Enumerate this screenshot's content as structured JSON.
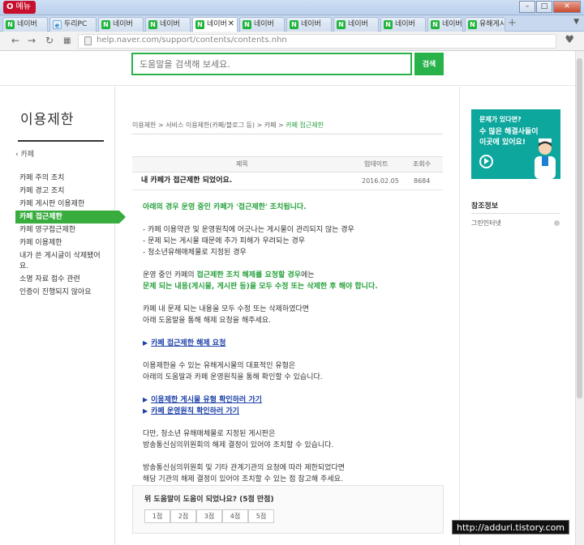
{
  "browser": {
    "menu_label": "메뉴",
    "tabs": [
      {
        "label": "네이버",
        "icon": "naver"
      },
      {
        "label": "두리PC",
        "icon": "ie"
      },
      {
        "label": "네이버",
        "icon": "naver"
      },
      {
        "label": "네이버",
        "icon": "naver"
      },
      {
        "label": "네이버",
        "icon": "naver"
      },
      {
        "label": "네이버",
        "icon": "naver"
      },
      {
        "label": "네이버",
        "icon": "naver"
      },
      {
        "label": "네이버",
        "icon": "naver"
      },
      {
        "label": "네이버",
        "icon": "naver"
      },
      {
        "label": "네이버",
        "icon": "naver"
      },
      {
        "label": "유해게시",
        "icon": "naver"
      }
    ],
    "url": "help.naver.com/support/contents/contents.nhn"
  },
  "search": {
    "placeholder": "도움말을 검색해 보세요.",
    "button_label": "검색"
  },
  "leftnav": {
    "title": "이용제한",
    "back_label": "카페",
    "items": [
      "카페 주의 조치",
      "카페 경고 조치",
      "카페 게시판 이용제한",
      "카페 접근제한",
      "카페 영구접근제한",
      "카페 이용제한",
      "내가 쓴 게시글이 삭제됐어요.",
      "소명 자료 접수 관련",
      "인증이 진행되지 않아요"
    ]
  },
  "breadcrumb": {
    "items": [
      "이용제한",
      "서비스 이용제한(카페/블로그 등)",
      "카페"
    ],
    "current": "카페 접근제한"
  },
  "table": {
    "headers": {
      "title": "제목",
      "date": "업데이트",
      "views": "조회수"
    },
    "row": {
      "title": "내 카페가 접근제한 되었어요.",
      "date": "2016.02.05",
      "views": "8684"
    }
  },
  "article": {
    "intro": "아래의 경우 운영 중인 카페가 '접근제한' 조치됩니다.",
    "bullets": [
      "- 카페 이용약관 및 운영원칙에 어긋나는 게시물이 관리되지 않는 경우",
      "- 문제 되는 게시물 때문에 추가 피해가 우려되는 경우",
      "- 청소년유해매체물로 지정된 경우"
    ],
    "p2_a": "운영 중인 카페의 ",
    "p2_b": "접근제한 조치 해제를 요청할 경우",
    "p2_c": "에는",
    "p2_line2_a": "문제 되는 내용(게시물, 게시판 등)",
    "p2_line2_b": "을 모두 수정 또는 삭제한 후 해야 합니다.",
    "p3": [
      "카페 내 문제 되는 내용을 모두 수정 또는 삭제하였다면",
      "아래 도움말을 통해 해제 요청을 해주세요."
    ],
    "link1": "카페 접근제한 해제 요청",
    "p4": [
      "이용제한을 수 있는 유해게시물의 대표적인 유형은",
      "아래의 도움말과 카페 운영원칙을 통해 확인할 수 있습니다."
    ],
    "link2": "이용제한 게시물 유형 확인하러 가기",
    "link3": "카페 운영원칙 확인하러 가기",
    "p5": [
      "다만, 청소년 유해매체물로 지정된 게시판은",
      "방송통신심의위원회의 해제 결정이 있어야 조치할 수 있습니다."
    ],
    "p6": [
      "방송통신심의위원회 및 기타 관계기관의 요청에 따라 제한되었다면",
      "해당 기관의 해제 결정이 있어야 조치할 수 있는 점 참고해 주세요."
    ]
  },
  "feedback": {
    "question": "위 도움말이 도움이 되었나요? (5점 만점)",
    "scores": [
      "1점",
      "2점",
      "3점",
      "4점",
      "5점"
    ]
  },
  "right": {
    "banner_l1": "문제가 있다면?",
    "banner_l2": "수 많은 해결사들이",
    "banner_l3": "이곳에 있어요!",
    "ref_title": "참조정보",
    "ref_item": "그린인터넷"
  },
  "watermark": "http://adduri.tistory.com",
  "colors": {
    "accent": "#27b24a",
    "nav_active": "#38ad3d",
    "link": "#1b3fa8",
    "banner": "#0da79e"
  }
}
